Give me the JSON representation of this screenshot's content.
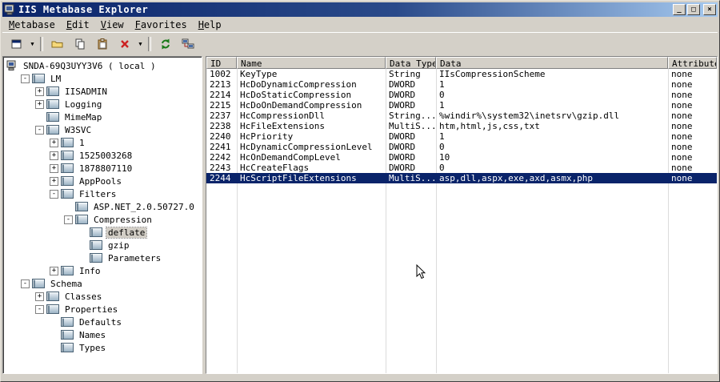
{
  "window": {
    "title": "IIS Metabase Explorer",
    "controls": {
      "minimize": "_",
      "maximize": "□",
      "close": "×"
    }
  },
  "colors": {
    "chrome": "#d4d0c8",
    "titlebar_left": "#0a246a",
    "titlebar_right": "#a6caf0",
    "selection_bg": "#0a246a",
    "selection_fg": "#ffffff",
    "inactive_selection_bg": "#d2cec6"
  },
  "menu": {
    "items": [
      {
        "label": "Metabase"
      },
      {
        "label": "Edit"
      },
      {
        "label": "View"
      },
      {
        "label": "Favorites"
      },
      {
        "label": "Help"
      }
    ]
  },
  "toolbar": {
    "buttons": [
      "new-key-dropdown",
      "open",
      "copy",
      "paste",
      "delete-dropdown",
      "refresh",
      "connect"
    ],
    "dropdown_glyph": "▼"
  },
  "tree": {
    "nodes": [
      {
        "label": "SNDA-69Q3UYY3V6 ( local )",
        "expander": "",
        "icon": "computer"
      },
      {
        "label": "LM",
        "expander": "-",
        "icon": "key"
      },
      {
        "label": "IISADMIN",
        "expander": "+",
        "icon": "key"
      },
      {
        "label": "Logging",
        "expander": "+",
        "icon": "key"
      },
      {
        "label": "MimeMap",
        "expander": "",
        "icon": "key"
      },
      {
        "label": "W3SVC",
        "expander": "-",
        "icon": "key"
      },
      {
        "label": "1",
        "expander": "+",
        "icon": "key"
      },
      {
        "label": "1525003268",
        "expander": "+",
        "icon": "key"
      },
      {
        "label": "1878807110",
        "expander": "+",
        "icon": "key"
      },
      {
        "label": "AppPools",
        "expander": "+",
        "icon": "key"
      },
      {
        "label": "Filters",
        "expander": "-",
        "icon": "key"
      },
      {
        "label": "ASP.NET_2.0.50727.0",
        "expander": "",
        "icon": "key"
      },
      {
        "label": "Compression",
        "expander": "-",
        "icon": "key"
      },
      {
        "label": "deflate",
        "expander": "",
        "icon": "key",
        "selected": true
      },
      {
        "label": "gzip",
        "expander": "",
        "icon": "key"
      },
      {
        "label": "Parameters",
        "expander": "",
        "icon": "key"
      },
      {
        "label": "Info",
        "expander": "+",
        "icon": "key"
      },
      {
        "label": "Schema",
        "expander": "-",
        "icon": "key"
      },
      {
        "label": "Classes",
        "expander": "+",
        "icon": "key"
      },
      {
        "label": "Properties",
        "expander": "-",
        "icon": "key"
      },
      {
        "label": "Defaults",
        "expander": "",
        "icon": "key"
      },
      {
        "label": "Names",
        "expander": "",
        "icon": "key"
      },
      {
        "label": "Types",
        "expander": "",
        "icon": "key"
      }
    ]
  },
  "table": {
    "columns": [
      "ID",
      "Name",
      "Data Type",
      "Data",
      "Attributes"
    ],
    "rows": [
      {
        "id": "1002",
        "name": "KeyType",
        "type": "String",
        "data": "IIsCompressionScheme",
        "attrs": "none"
      },
      {
        "id": "2213",
        "name": "HcDoDynamicCompression",
        "type": "DWORD",
        "data": "1",
        "attrs": "none"
      },
      {
        "id": "2214",
        "name": "HcDoStaticCompression",
        "type": "DWORD",
        "data": "0",
        "attrs": "none"
      },
      {
        "id": "2215",
        "name": "HcDoOnDemandCompression",
        "type": "DWORD",
        "data": "1",
        "attrs": "none"
      },
      {
        "id": "2237",
        "name": "HcCompressionDll",
        "type": "String...",
        "data": "%windir%\\system32\\inetsrv\\gzip.dll",
        "attrs": "none"
      },
      {
        "id": "2238",
        "name": "HcFileExtensions",
        "type": "MultiS...",
        "data": "htm,html,js,css,txt",
        "attrs": "none"
      },
      {
        "id": "2240",
        "name": "HcPriority",
        "type": "DWORD",
        "data": "1",
        "attrs": "none"
      },
      {
        "id": "2241",
        "name": "HcDynamicCompressionLevel",
        "type": "DWORD",
        "data": "0",
        "attrs": "none"
      },
      {
        "id": "2242",
        "name": "HcOnDemandCompLevel",
        "type": "DWORD",
        "data": "10",
        "attrs": "none"
      },
      {
        "id": "2243",
        "name": "HcCreateFlags",
        "type": "DWORD",
        "data": "0",
        "attrs": "none"
      },
      {
        "id": "2244",
        "name": "HcScriptFileExtensions",
        "type": "MultiS...",
        "data": "asp,dll,aspx,exe,axd,asmx,php",
        "attrs": "none",
        "selected": true
      }
    ]
  }
}
